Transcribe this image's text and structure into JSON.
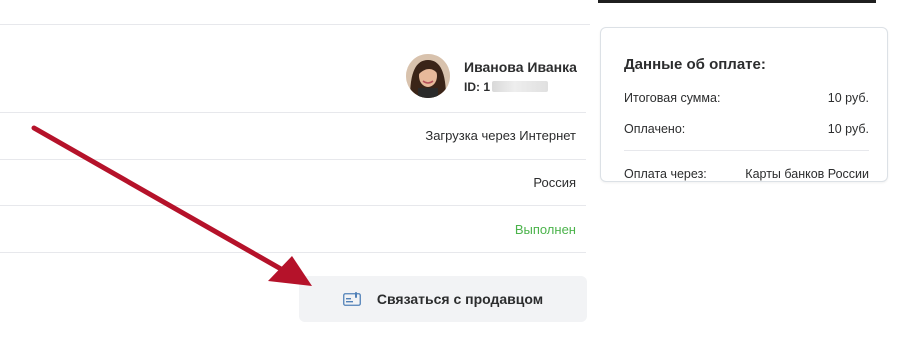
{
  "user": {
    "name": "Иванова Иванка",
    "id_label": "ID: 1"
  },
  "order": {
    "delivery": "Загрузка через Интернет",
    "country": "Россия",
    "status": "Выполнен"
  },
  "contact_button": {
    "label": "Связаться с продавцом",
    "icon": "contact-card-icon"
  },
  "payment": {
    "title": "Данные об оплате:",
    "total_label": "Итоговая сумма:",
    "total_value": "10 руб.",
    "paid_label": "Оплачено:",
    "paid_value": "10 руб.",
    "method_label": "Оплата через:",
    "method_value": "Карты банков России"
  },
  "colors": {
    "status_green": "#4bb34b",
    "annotation_arrow": "#b5122a",
    "button_bg": "#f2f3f5"
  }
}
